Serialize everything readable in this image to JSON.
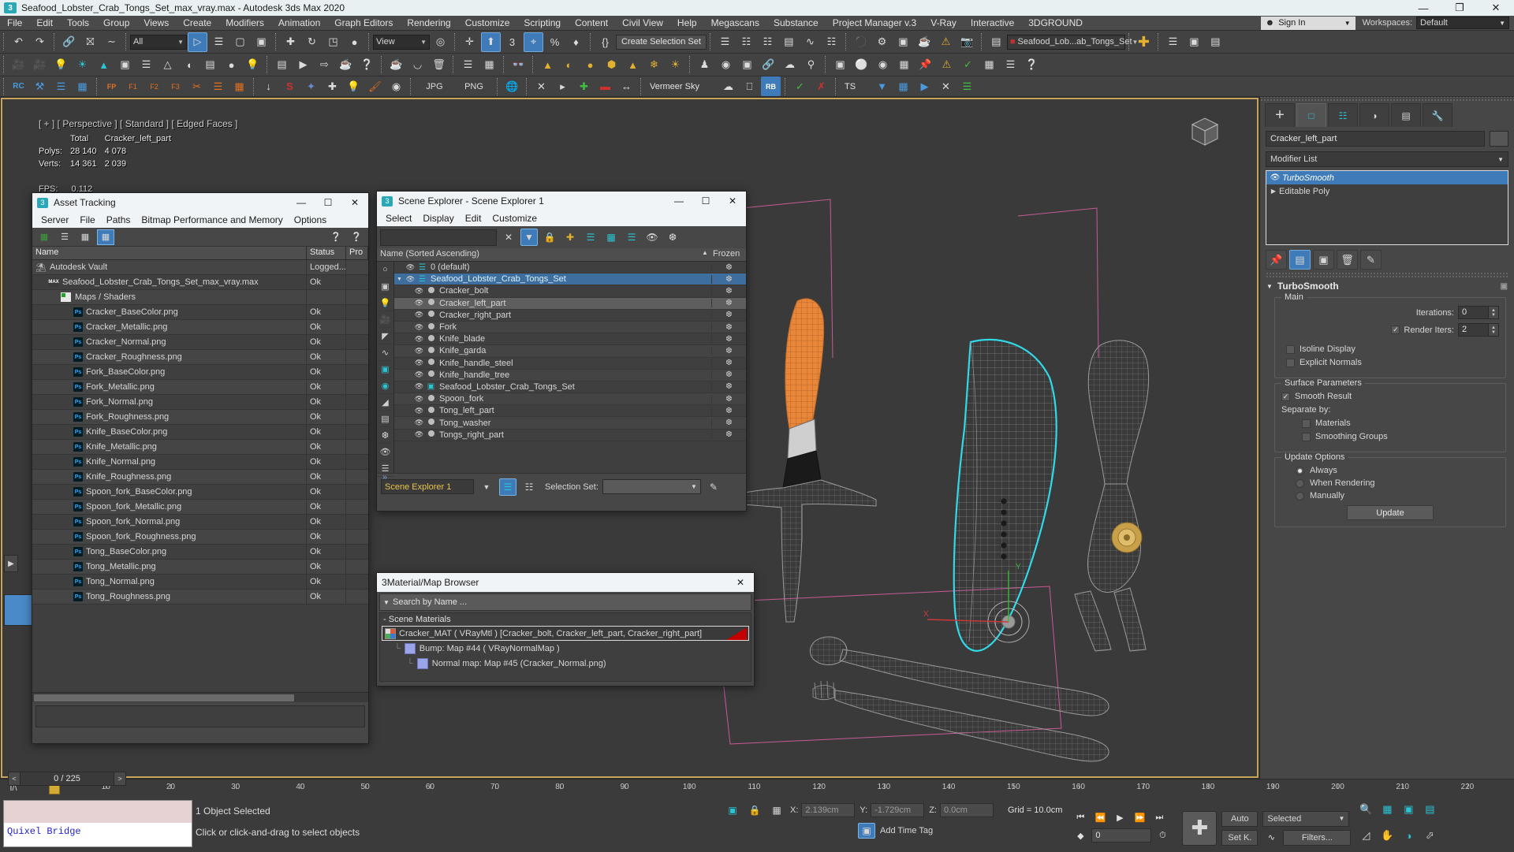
{
  "titlebar": {
    "icon": "3ds-max-icon",
    "title": "Seafood_Lobster_Crab_Tongs_Set_max_vray.max - Autodesk 3ds Max 2020",
    "minimize": "—",
    "maximize": "❐",
    "close": "✕"
  },
  "menubar": {
    "items": [
      {
        "label": "File"
      },
      {
        "label": "Edit"
      },
      {
        "label": "Tools"
      },
      {
        "label": "Group"
      },
      {
        "label": "Views"
      },
      {
        "label": "Create"
      },
      {
        "label": "Modifiers"
      },
      {
        "label": "Animation"
      },
      {
        "label": "Graph Editors"
      },
      {
        "label": "Rendering"
      },
      {
        "label": "Customize"
      },
      {
        "label": "Scripting"
      },
      {
        "label": "Content"
      },
      {
        "label": "Civil View"
      },
      {
        "label": "Help"
      },
      {
        "label": "Megascans"
      },
      {
        "label": "Substance"
      },
      {
        "label": "Project Manager v.3"
      },
      {
        "label": "V-Ray"
      },
      {
        "label": "Interactive"
      },
      {
        "label": "3DGROUND"
      }
    ],
    "signin": "Sign In",
    "workspaces_label": "Workspaces:",
    "workspace_value": "Default"
  },
  "toolbar": {
    "selection_filter": "All",
    "reference_coord": "View",
    "create_selection_set": "Create Selection Set",
    "named_set": "Seafood_Lob...ab_Tongs_Set",
    "snaps_percent": "%",
    "jpg": "JPG",
    "png": "PNG",
    "env": "Vermeer Sky",
    "ts": "TS",
    "rb": "RB",
    "rc": "RC",
    "fp": "FP"
  },
  "viewport": {
    "label": "[ + ] [ Perspective ] [ Standard ] [ Edged Faces ]",
    "stats": {
      "col_total": "Total",
      "col_object": "Cracker_left_part",
      "polys_label": "Polys:",
      "polys_total": "28 140",
      "polys_object": "4 078",
      "verts_label": "Verts:",
      "verts_total": "14 361",
      "verts_object": "2 039",
      "fps_label": "FPS:",
      "fps_value": "0.112"
    }
  },
  "asset_tracking": {
    "window_title": "Asset Tracking",
    "menu": [
      "Server",
      "File",
      "Paths",
      "Bitmap Performance and Memory",
      "Options"
    ],
    "columns": [
      "Name",
      "Status",
      "Pro"
    ],
    "rows": [
      {
        "name": "Autodesk Vault",
        "status": "Logged...",
        "icon": "vault-icon",
        "indent": 0
      },
      {
        "name": "Seafood_Lobster_Crab_Tongs_Set_max_vray.max",
        "status": "Ok",
        "icon": "max-icon",
        "indent": 1
      },
      {
        "name": "Maps / Shaders",
        "status": "",
        "icon": "maps-icon",
        "indent": 2
      },
      {
        "name": "Cracker_BaseColor.png",
        "status": "Ok",
        "icon": "ps-icon",
        "indent": 3
      },
      {
        "name": "Cracker_Metallic.png",
        "status": "Ok",
        "icon": "ps-icon",
        "indent": 3
      },
      {
        "name": "Cracker_Normal.png",
        "status": "Ok",
        "icon": "ps-icon",
        "indent": 3
      },
      {
        "name": "Cracker_Roughness.png",
        "status": "Ok",
        "icon": "ps-icon",
        "indent": 3
      },
      {
        "name": "Fork_BaseColor.png",
        "status": "Ok",
        "icon": "ps-icon",
        "indent": 3
      },
      {
        "name": "Fork_Metallic.png",
        "status": "Ok",
        "icon": "ps-icon",
        "indent": 3
      },
      {
        "name": "Fork_Normal.png",
        "status": "Ok",
        "icon": "ps-icon",
        "indent": 3
      },
      {
        "name": "Fork_Roughness.png",
        "status": "Ok",
        "icon": "ps-icon",
        "indent": 3
      },
      {
        "name": "Knife_BaseColor.png",
        "status": "Ok",
        "icon": "ps-icon",
        "indent": 3
      },
      {
        "name": "Knife_Metallic.png",
        "status": "Ok",
        "icon": "ps-icon",
        "indent": 3
      },
      {
        "name": "Knife_Normal.png",
        "status": "Ok",
        "icon": "ps-icon",
        "indent": 3
      },
      {
        "name": "Knife_Roughness.png",
        "status": "Ok",
        "icon": "ps-icon",
        "indent": 3
      },
      {
        "name": "Spoon_fork_BaseColor.png",
        "status": "Ok",
        "icon": "ps-icon",
        "indent": 3
      },
      {
        "name": "Spoon_fork_Metallic.png",
        "status": "Ok",
        "icon": "ps-icon",
        "indent": 3
      },
      {
        "name": "Spoon_fork_Normal.png",
        "status": "Ok",
        "icon": "ps-icon",
        "indent": 3
      },
      {
        "name": "Spoon_fork_Roughness.png",
        "status": "Ok",
        "icon": "ps-icon",
        "indent": 3
      },
      {
        "name": "Tong_BaseColor.png",
        "status": "Ok",
        "icon": "ps-icon",
        "indent": 3
      },
      {
        "name": "Tong_Metallic.png",
        "status": "Ok",
        "icon": "ps-icon",
        "indent": 3
      },
      {
        "name": "Tong_Normal.png",
        "status": "Ok",
        "icon": "ps-icon",
        "indent": 3
      },
      {
        "name": "Tong_Roughness.png",
        "status": "Ok",
        "icon": "ps-icon",
        "indent": 3
      }
    ]
  },
  "scene_explorer": {
    "window_title": "Scene Explorer - Scene Explorer 1",
    "menu": [
      "Select",
      "Display",
      "Edit",
      "Customize"
    ],
    "search_value": "",
    "column_name": "Name (Sorted Ascending)",
    "column_frozen": "Frozen",
    "sort_arrow": "▲",
    "rows": [
      {
        "name": "0 (default)",
        "type": "layer",
        "indent": 0,
        "state": "normal"
      },
      {
        "name": "Seafood_Lobster_Crab_Tongs_Set",
        "type": "layer",
        "indent": 0,
        "state": "selected",
        "expanded": true
      },
      {
        "name": "Cracker_bolt",
        "type": "object",
        "indent": 1,
        "state": "normal"
      },
      {
        "name": "Cracker_left_part",
        "type": "object",
        "indent": 1,
        "state": "highlight"
      },
      {
        "name": "Cracker_right_part",
        "type": "object",
        "indent": 1,
        "state": "normal"
      },
      {
        "name": "Fork",
        "type": "object",
        "indent": 1,
        "state": "normal"
      },
      {
        "name": "Knife_blade",
        "type": "object",
        "indent": 1,
        "state": "normal"
      },
      {
        "name": "Knife_garda",
        "type": "object",
        "indent": 1,
        "state": "normal"
      },
      {
        "name": "Knife_handle_steel",
        "type": "object",
        "indent": 1,
        "state": "normal"
      },
      {
        "name": "Knife_handle_tree",
        "type": "object",
        "indent": 1,
        "state": "normal"
      },
      {
        "name": "Seafood_Lobster_Crab_Tongs_Set",
        "type": "group",
        "indent": 1,
        "state": "normal"
      },
      {
        "name": "Spoon_fork",
        "type": "object",
        "indent": 1,
        "state": "normal"
      },
      {
        "name": "Tong_left_part",
        "type": "object",
        "indent": 1,
        "state": "normal"
      },
      {
        "name": "Tong_washer",
        "type": "object",
        "indent": 1,
        "state": "normal"
      },
      {
        "name": "Tongs_right_part",
        "type": "object",
        "indent": 1,
        "state": "normal"
      }
    ],
    "footer": {
      "explorer_name": "Scene Explorer 1",
      "selection_set_label": "Selection Set:",
      "selection_set_value": ""
    }
  },
  "material_browser": {
    "window_title": "Material/Map Browser",
    "search_placeholder": "Search by Name ...",
    "group_label": "Scene Materials",
    "rows": [
      {
        "text": "Cracker_MAT  ( VRayMtl )  [Cracker_bolt, Cracker_left_part, Cracker_right_part]",
        "kind": "material",
        "indent": 0
      },
      {
        "text": "Bump: Map #44  ( VRayNormalMap )",
        "kind": "map",
        "indent": 1
      },
      {
        "text": "Normal map: Map #45 (Cracker_Normal.png)",
        "kind": "map",
        "indent": 2
      }
    ]
  },
  "command_panel": {
    "tabs": [
      "create-tab",
      "modify-tab",
      "hierarchy-tab",
      "motion-tab",
      "display-tab",
      "utilities-tab"
    ],
    "active_tab_index": 1,
    "object_name": "Cracker_left_part",
    "modifier_list_label": "Modifier List",
    "modifier_stack": [
      {
        "name": "TurboSmooth",
        "selected": true,
        "italic": true
      },
      {
        "name": "Editable Poly",
        "selected": false,
        "italic": false
      }
    ],
    "rollout": {
      "title": "TurboSmooth",
      "main_group": "Main",
      "iterations_label": "Iterations:",
      "iterations_value": "0",
      "render_iters_label": "Render Iters:",
      "render_iters_value": "2",
      "render_iters_checked": true,
      "isoline_display_label": "Isoline Display",
      "isoline_display_checked": false,
      "explicit_normals_label": "Explicit Normals",
      "explicit_normals_checked": false,
      "surface_group": "Surface Parameters",
      "smooth_result_label": "Smooth Result",
      "smooth_result_checked": true,
      "separate_by_label": "Separate by:",
      "materials_label": "Materials",
      "materials_checked": false,
      "smoothing_groups_label": "Smoothing Groups",
      "smoothing_groups_checked": false,
      "update_group": "Update Options",
      "update_options": [
        {
          "label": "Always",
          "selected": true
        },
        {
          "label": "When Rendering",
          "selected": false
        },
        {
          "label": "Manually",
          "selected": false
        }
      ],
      "update_button": "Update"
    }
  },
  "timeline": {
    "frame_field": "0 / 225",
    "prev_frame": "<",
    "next_frame": ">",
    "ticks": [
      10,
      20,
      30,
      40,
      50,
      60,
      70,
      80,
      90,
      100,
      110,
      120,
      130,
      140,
      150,
      160,
      170,
      180,
      190,
      200,
      210,
      220
    ]
  },
  "statusbar": {
    "listener_text": "Quixel Bridge",
    "message_primary": "1 Object Selected",
    "message_secondary": "Click or click-and-drag to select objects",
    "x_label": "X:",
    "x_value": "2.139cm",
    "y_label": "Y:",
    "y_value": "-1.729cm",
    "z_label": "Z:",
    "z_value": "0.0cm",
    "grid_text": "Grid = 10.0cm",
    "add_time_tag": "Add Time Tag",
    "auto_key": "Auto",
    "set_key": "Set K.",
    "key_filter_value": "Selected",
    "filters_button": "Filters...",
    "current_frame": "0"
  }
}
